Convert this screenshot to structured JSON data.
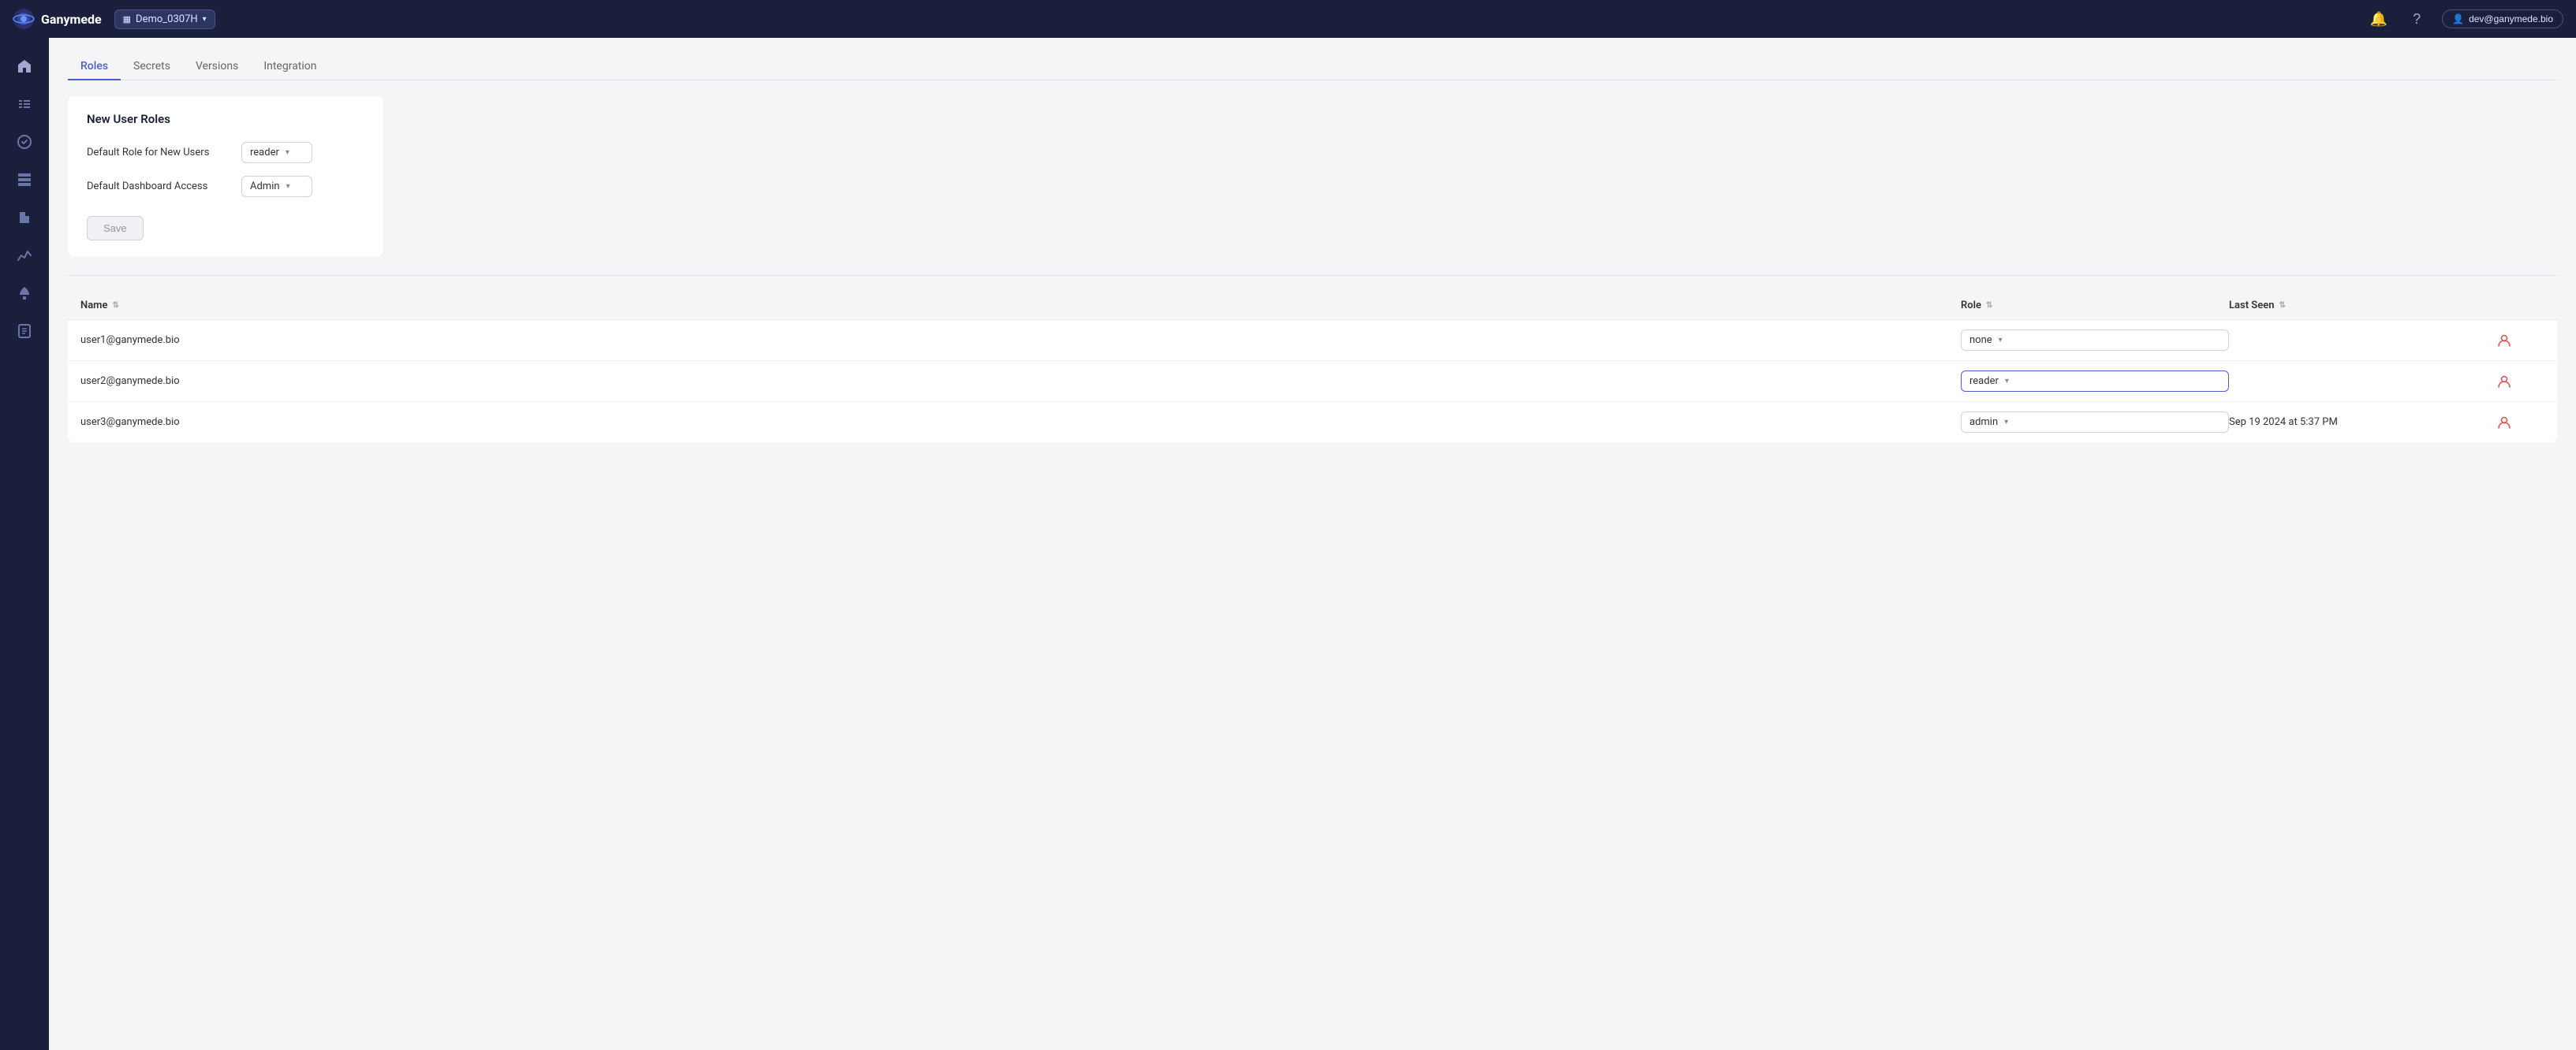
{
  "header": {
    "logo_text": "Ganymede",
    "workspace_label": "Demo_0307H",
    "user_email": "dev@ganymede.bio"
  },
  "tabs": [
    {
      "id": "roles",
      "label": "Roles",
      "active": true
    },
    {
      "id": "secrets",
      "label": "Secrets",
      "active": false
    },
    {
      "id": "versions",
      "label": "Versions",
      "active": false
    },
    {
      "id": "integration",
      "label": "Integration",
      "active": false
    }
  ],
  "new_user_roles": {
    "title": "New User Roles",
    "default_role_label": "Default Role for New Users",
    "default_role_value": "reader",
    "default_dashboard_label": "Default Dashboard Access",
    "default_dashboard_value": "Admin",
    "save_label": "Save"
  },
  "table": {
    "columns": [
      {
        "id": "name",
        "label": "Name"
      },
      {
        "id": "role",
        "label": "Role"
      },
      {
        "id": "last_seen",
        "label": "Last Seen"
      },
      {
        "id": "actions",
        "label": ""
      }
    ],
    "rows": [
      {
        "name": "user1@ganymede.bio",
        "role": "none",
        "role_highlighted": false,
        "last_seen": ""
      },
      {
        "name": "user2@ganymede.bio",
        "role": "reader",
        "role_highlighted": true,
        "last_seen": ""
      },
      {
        "name": "user3@ganymede.bio",
        "role": "admin",
        "role_highlighted": false,
        "last_seen": "Sep 19 2024 at 5:37 PM"
      }
    ]
  },
  "sidebar": {
    "items": [
      {
        "id": "home",
        "icon": "⌂",
        "label": "Home"
      },
      {
        "id": "pipeline",
        "icon": "⑂",
        "label": "Pipeline"
      },
      {
        "id": "tasks",
        "icon": "✓",
        "label": "Tasks"
      },
      {
        "id": "table",
        "icon": "▦",
        "label": "Table"
      },
      {
        "id": "files",
        "icon": "📁",
        "label": "Files"
      },
      {
        "id": "analytics",
        "icon": "📈",
        "label": "Analytics"
      },
      {
        "id": "deploy",
        "icon": "🚀",
        "label": "Deploy"
      },
      {
        "id": "reports",
        "icon": "📋",
        "label": "Reports"
      }
    ]
  }
}
